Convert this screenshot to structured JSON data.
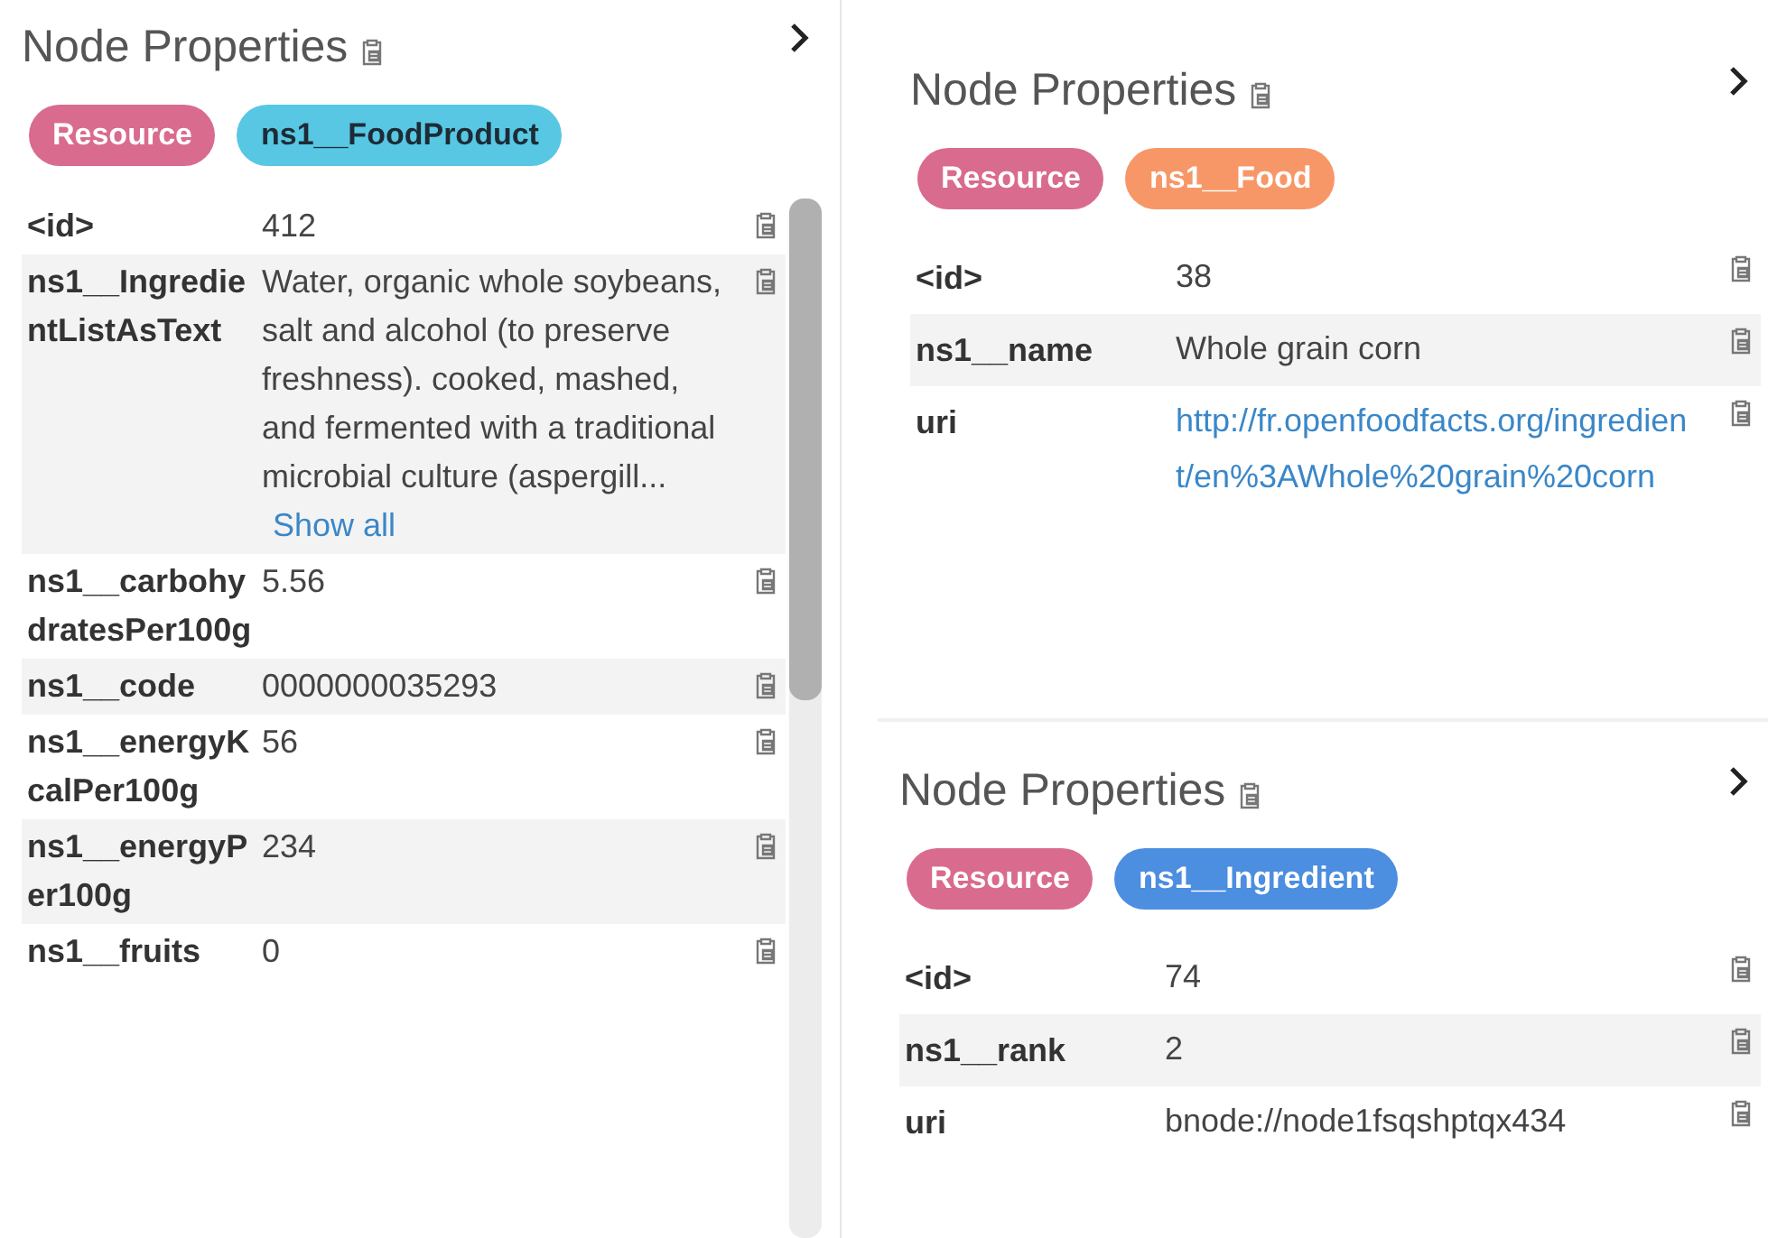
{
  "panels": [
    {
      "title": "Node Properties",
      "labels": [
        {
          "text": "Resource",
          "color": "#d96b8e"
        },
        {
          "text": "ns1__FoodProduct",
          "color": "#57c7e3"
        }
      ],
      "properties": [
        {
          "key": "<id>",
          "value": "412"
        },
        {
          "key": "ns1__IngredientListAsText",
          "value": "Water, organic whole soybeans, salt and alcohol (to preserve freshness). cooked, mashed, and fermented with a traditional microbial culture (aspergill...",
          "show_all": "Show all"
        },
        {
          "key": "ns1__carbohydratesPer100g",
          "value": "5.56"
        },
        {
          "key": "ns1__code",
          "value": "0000000035293"
        },
        {
          "key": "ns1__energyKcalPer100g",
          "value": "56"
        },
        {
          "key": "ns1__energyPer100g",
          "value": "234"
        },
        {
          "key": "ns1__fruits",
          "value": "0"
        }
      ]
    },
    {
      "title": "Node Properties",
      "labels": [
        {
          "text": "Resource",
          "color": "#d96b8e"
        },
        {
          "text": "ns1__Food",
          "color": "#f79767"
        }
      ],
      "properties": [
        {
          "key": "<id>",
          "value": "38"
        },
        {
          "key": "ns1__name",
          "value": "Whole grain corn"
        },
        {
          "key": "uri",
          "value": "http://fr.openfoodfacts.org/ingredient/en%3AWhole%20grain%20corn",
          "kind": "link"
        }
      ]
    },
    {
      "title": "Node Properties",
      "labels": [
        {
          "text": "Resource",
          "color": "#d96b8e"
        },
        {
          "text": "ns1__Ingredient",
          "color": "#4c8ee0"
        }
      ],
      "properties": [
        {
          "key": "<id>",
          "value": "74"
        },
        {
          "key": "ns1__rank",
          "value": "2"
        },
        {
          "key": "uri",
          "value": "bnode://node1fsqshptqx434"
        }
      ]
    }
  ]
}
